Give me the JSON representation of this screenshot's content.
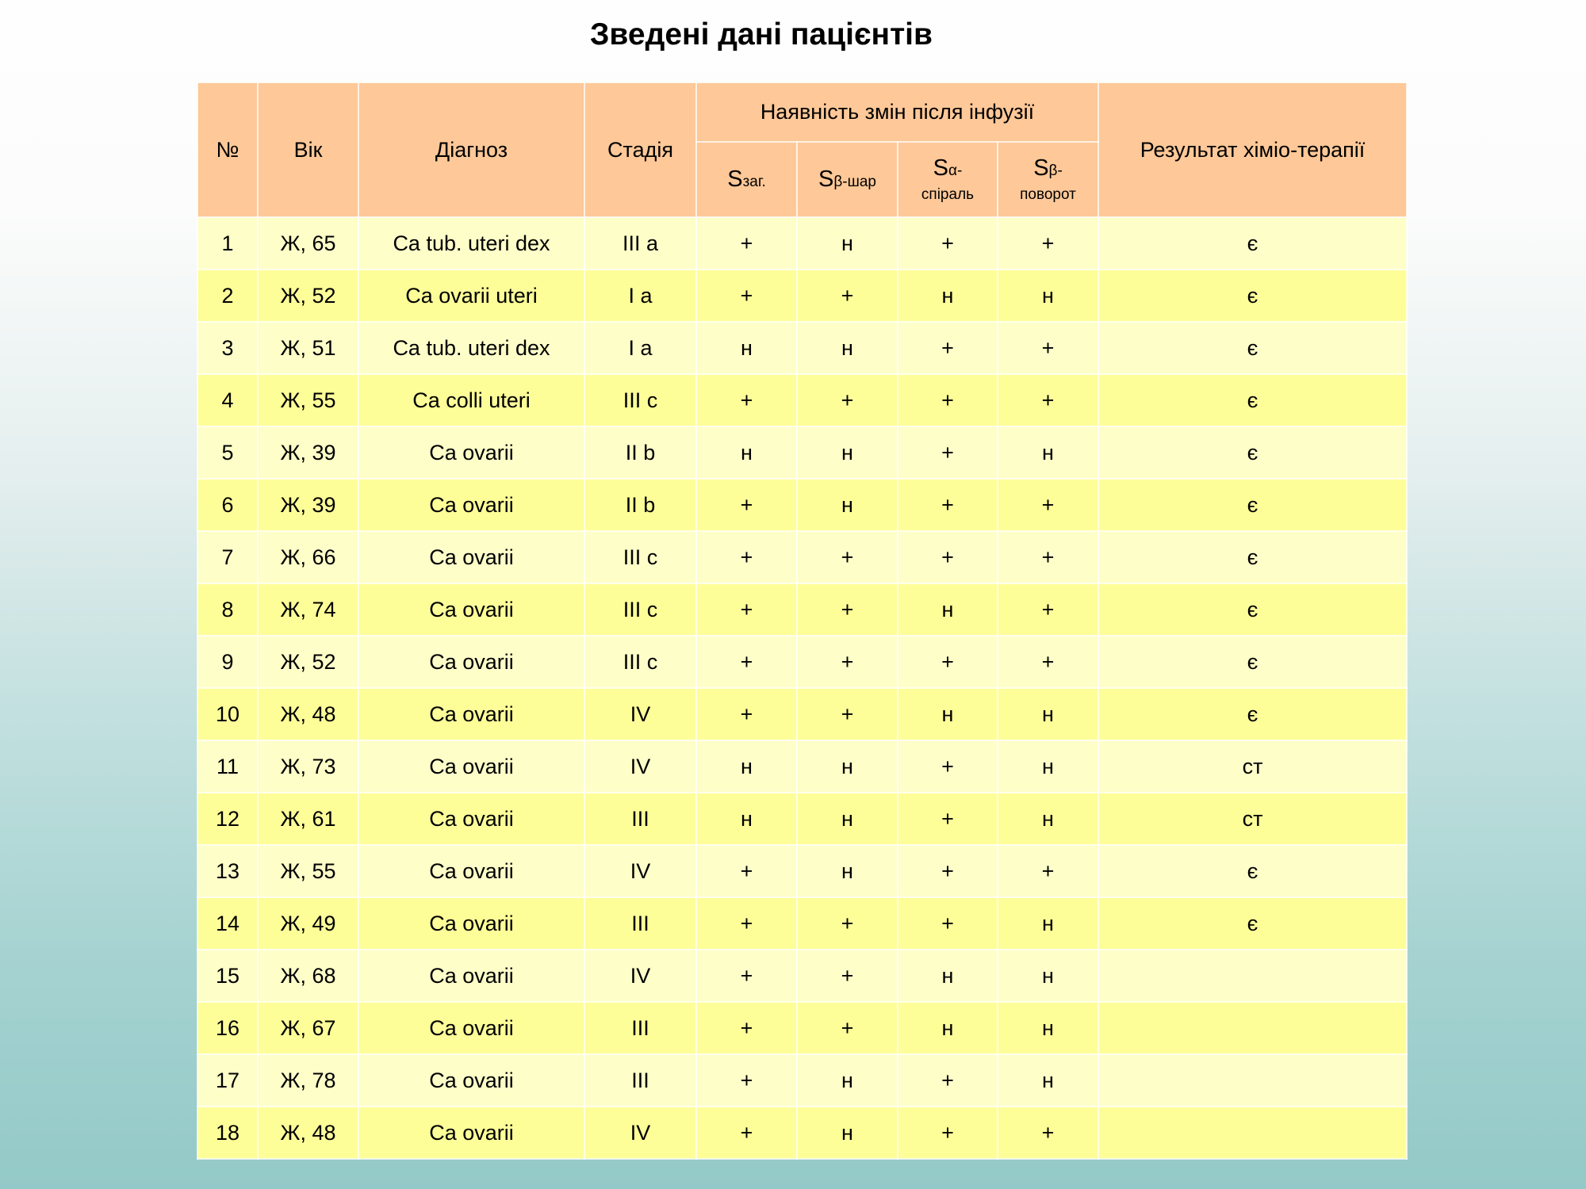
{
  "title": "Зведені дані пацієнтів",
  "headers": {
    "no": "№",
    "age": "Вік",
    "diagnosis": "Діагноз",
    "stage": "Стадія",
    "group": "Наявність змін після інфузії",
    "result": "Результат хіміо-терапії",
    "s_total": {
      "main": "S",
      "sub": "заг."
    },
    "s_beta_layer": {
      "main": "S",
      "sub": "β-шар"
    },
    "s_alpha_helix": {
      "main": "S",
      "sub1": "α-",
      "sub2": "спіраль"
    },
    "s_beta_turn": {
      "main": "S",
      "sub1": "β-",
      "sub2": "поворот"
    }
  },
  "rows": [
    {
      "no": "1",
      "age": "Ж, 65",
      "diagnosis": "Ca tub. uteri dex",
      "stage": "III a",
      "s_total": "+",
      "s_beta_layer": "н",
      "s_alpha_helix": "+",
      "s_beta_turn": "+",
      "result": "є"
    },
    {
      "no": "2",
      "age": "Ж, 52",
      "diagnosis": "Ca ovarii uteri",
      "stage": "I a",
      "s_total": "+",
      "s_beta_layer": "+",
      "s_alpha_helix": "н",
      "s_beta_turn": "н",
      "result": "є"
    },
    {
      "no": "3",
      "age": "Ж, 51",
      "diagnosis": "Ca tub. uteri dex",
      "stage": "I a",
      "s_total": "н",
      "s_beta_layer": "н",
      "s_alpha_helix": "+",
      "s_beta_turn": "+",
      "result": "є"
    },
    {
      "no": "4",
      "age": "Ж, 55",
      "diagnosis": "Ca colli uteri",
      "stage": "III c",
      "s_total": "+",
      "s_beta_layer": "+",
      "s_alpha_helix": "+",
      "s_beta_turn": "+",
      "result": "є"
    },
    {
      "no": "5",
      "age": "Ж, 39",
      "diagnosis": "Ca ovarii",
      "stage": "II b",
      "s_total": "н",
      "s_beta_layer": "н",
      "s_alpha_helix": "+",
      "s_beta_turn": "н",
      "result": "є"
    },
    {
      "no": "6",
      "age": "Ж, 39",
      "diagnosis": "Ca ovarii",
      "stage": "II b",
      "s_total": "+",
      "s_beta_layer": "н",
      "s_alpha_helix": "+",
      "s_beta_turn": "+",
      "result": "є"
    },
    {
      "no": "7",
      "age": "Ж, 66",
      "diagnosis": "Ca ovarii",
      "stage": "III c",
      "s_total": "+",
      "s_beta_layer": "+",
      "s_alpha_helix": "+",
      "s_beta_turn": "+",
      "result": "є"
    },
    {
      "no": "8",
      "age": "Ж, 74",
      "diagnosis": "Ca ovarii",
      "stage": "III c",
      "s_total": "+",
      "s_beta_layer": "+",
      "s_alpha_helix": "н",
      "s_beta_turn": "+",
      "result": "є"
    },
    {
      "no": "9",
      "age": "Ж, 52",
      "diagnosis": "Ca ovarii",
      "stage": "III c",
      "s_total": "+",
      "s_beta_layer": "+",
      "s_alpha_helix": "+",
      "s_beta_turn": "+",
      "result": "є"
    },
    {
      "no": "10",
      "age": "Ж, 48",
      "diagnosis": "Ca ovarii",
      "stage": "IV",
      "s_total": "+",
      "s_beta_layer": "+",
      "s_alpha_helix": "н",
      "s_beta_turn": "н",
      "result": "є"
    },
    {
      "no": "11",
      "age": "Ж, 73",
      "diagnosis": "Ca ovarii",
      "stage": "IV",
      "s_total": "н",
      "s_beta_layer": "н",
      "s_alpha_helix": "+",
      "s_beta_turn": "н",
      "result": "ст"
    },
    {
      "no": "12",
      "age": "Ж, 61",
      "diagnosis": "Ca ovarii",
      "stage": "III",
      "s_total": "н",
      "s_beta_layer": "н",
      "s_alpha_helix": "+",
      "s_beta_turn": "н",
      "result": "ст"
    },
    {
      "no": "13",
      "age": "Ж, 55",
      "diagnosis": "Ca ovarii",
      "stage": "IV",
      "s_total": "+",
      "s_beta_layer": "н",
      "s_alpha_helix": "+",
      "s_beta_turn": "+",
      "result": "є"
    },
    {
      "no": "14",
      "age": "Ж, 49",
      "diagnosis": "Ca ovarii",
      "stage": "III",
      "s_total": "+",
      "s_beta_layer": "+",
      "s_alpha_helix": "+",
      "s_beta_turn": "н",
      "result": "є"
    },
    {
      "no": "15",
      "age": "Ж, 68",
      "diagnosis": "Ca ovarii",
      "stage": "IV",
      "s_total": "+",
      "s_beta_layer": "+",
      "s_alpha_helix": "н",
      "s_beta_turn": "н",
      "result": ""
    },
    {
      "no": "16",
      "age": "Ж, 67",
      "diagnosis": "Ca ovarii",
      "stage": "III",
      "s_total": "+",
      "s_beta_layer": "+",
      "s_alpha_helix": "н",
      "s_beta_turn": "н",
      "result": ""
    },
    {
      "no": "17",
      "age": "Ж, 78",
      "diagnosis": "Ca ovarii",
      "stage": "III",
      "s_total": "+",
      "s_beta_layer": "н",
      "s_alpha_helix": "+",
      "s_beta_turn": "н",
      "result": ""
    },
    {
      "no": "18",
      "age": "Ж, 48",
      "diagnosis": "Ca ovarii",
      "stage": "IV",
      "s_total": "+",
      "s_beta_layer": "н",
      "s_alpha_helix": "+",
      "s_beta_turn": "+",
      "result": ""
    }
  ],
  "colors": {
    "header_bg": "#fec898",
    "row_light": "#fefec9",
    "row_yellow": "#fefe99",
    "bg_top": "#fefefe",
    "bg_bottom": "#93c9c8"
  }
}
